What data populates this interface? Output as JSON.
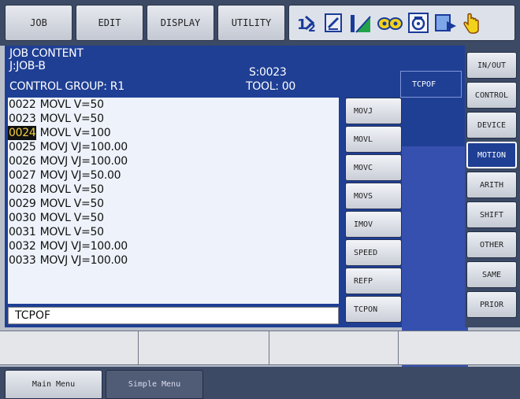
{
  "top_menu": [
    "JOB",
    "EDIT",
    "DISPLAY",
    "UTILITY"
  ],
  "status_icons": [
    "step-number-icon",
    "edit-lock-icon",
    "signal-level-icon",
    "glasses-icon",
    "teach-mode-icon",
    "play-icon",
    "hand-icon"
  ],
  "job_header": {
    "title": "JOB CONTENT",
    "job": "J:JOB-B",
    "step": "S:0023",
    "group": "CONTROL GROUP: R1",
    "tool": "TOOL: 00"
  },
  "job_lines": [
    {
      "num": "0022",
      "text": " MOVL V=50"
    },
    {
      "num": "0023",
      "text": " MOVL V=50"
    },
    {
      "num": "0024",
      "text": " MOVL V=100",
      "current": true
    },
    {
      "num": "0025",
      "text": " MOVJ VJ=100.00"
    },
    {
      "num": "0026",
      "text": " MOVJ VJ=100.00"
    },
    {
      "num": "0027",
      "text": " MOVJ VJ=50.00"
    },
    {
      "num": "0028",
      "text": " MOVL V=50"
    },
    {
      "num": "0029",
      "text": " MOVL V=50"
    },
    {
      "num": "0030",
      "text": " MOVL V=50"
    },
    {
      "num": "0031",
      "text": " MOVL V=50"
    },
    {
      "num": "0032",
      "text": " MOVJ VJ=100.00"
    },
    {
      "num": "0033",
      "text": " MOVJ VJ=100.00"
    }
  ],
  "input_line": "TCPOF",
  "instruction_menu": [
    "MOVJ",
    "MOVL",
    "MOVC",
    "MOVS",
    "IMOV",
    "SPEED",
    "REFP",
    "TCPON"
  ],
  "instruction_submenu_selected": "TCPOF",
  "category_menu": [
    "IN/OUT",
    "CONTROL",
    "DEVICE",
    "MOTION",
    "ARITH",
    "SHIFT",
    "OTHER",
    "SAME",
    "PRIOR"
  ],
  "category_selected": "MOTION",
  "bottom_menu": {
    "main": "Main Menu",
    "simple": "Simple Menu"
  },
  "colors": {
    "panel": "#1f3f94",
    "cursor_highlight": "#f4d040",
    "frame": "#3c4a66"
  }
}
